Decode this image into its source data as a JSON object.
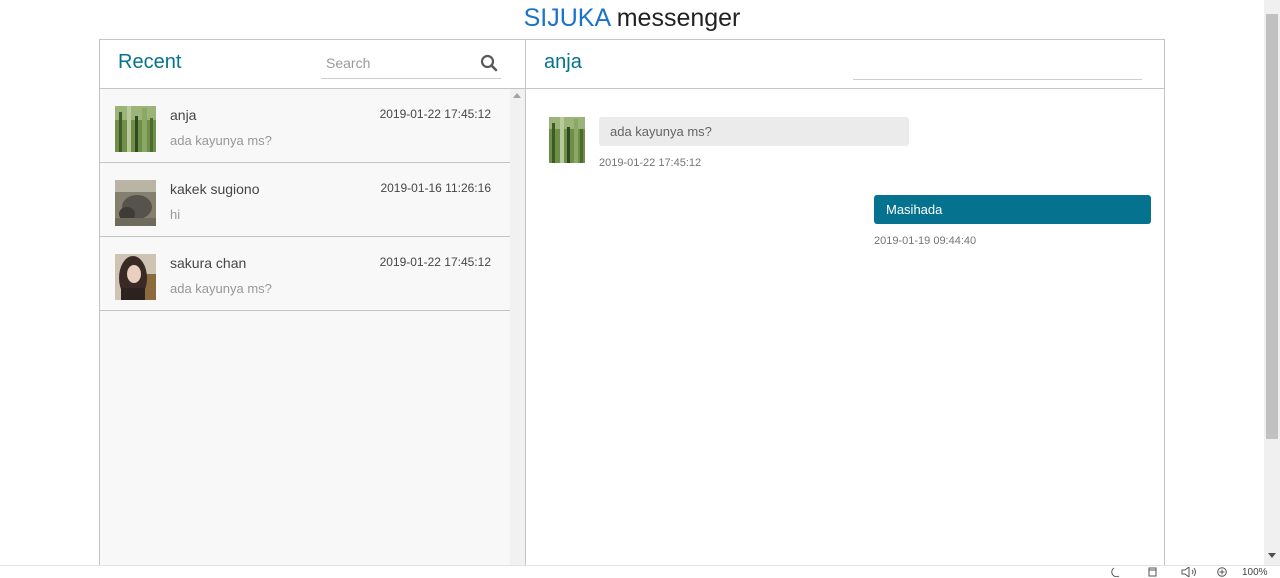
{
  "app": {
    "brand": "SIJUKA",
    "title_rest": " messenger"
  },
  "inbox": {
    "heading": "Recent",
    "search_placeholder": "Search",
    "chats": [
      {
        "name": "anja",
        "date": "2019-01-22 17:45:12",
        "preview": "ada kayunya ms?"
      },
      {
        "name": "kakek sugiono",
        "date": "2019-01-16 11:26:16",
        "preview": "hi"
      },
      {
        "name": "sakura chan",
        "date": "2019-01-22 17:45:12",
        "preview": "ada kayunya ms?"
      }
    ]
  },
  "conversation": {
    "contact_name": "anja",
    "messages": [
      {
        "direction": "incoming",
        "text": "ada kayunya ms?",
        "time": "2019-01-22 17:45:12"
      },
      {
        "direction": "outgoing",
        "text": "Masihada",
        "time": "2019-01-19 09:44:40"
      }
    ]
  },
  "status_bar": {
    "zoom": "100%"
  },
  "colors": {
    "accent": "#05728f",
    "brand_blue": "#1a73c9",
    "incoming_bubble": "#ebebeb"
  }
}
